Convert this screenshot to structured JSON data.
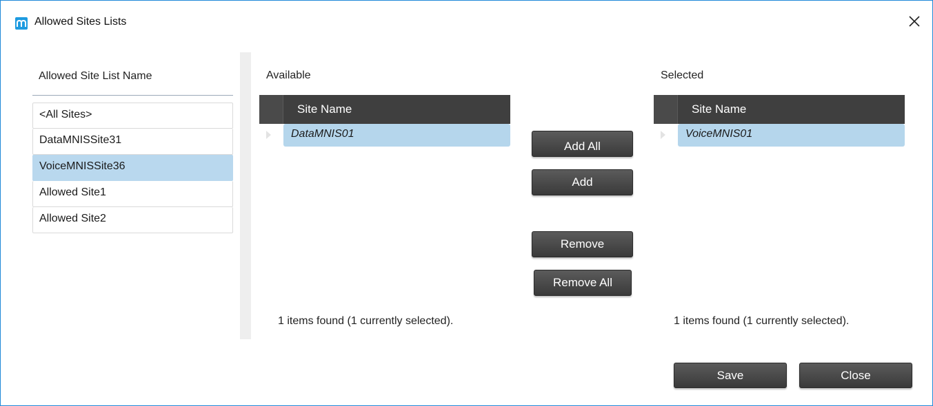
{
  "window": {
    "title": "Allowed Sites Lists",
    "close_symbol": "close-icon"
  },
  "site_list": {
    "header": "Allowed Site List Name",
    "items": [
      {
        "label": "<All Sites>",
        "selected": false
      },
      {
        "label": "DataMNISSite31",
        "selected": false
      },
      {
        "label": "VoiceMNISSite36",
        "selected": true
      },
      {
        "label": "Allowed Site1",
        "selected": false
      },
      {
        "label": "Allowed Site2",
        "selected": false
      }
    ]
  },
  "available": {
    "label": "Available",
    "column": "Site Name",
    "rows": [
      "DataMNIS01"
    ],
    "count_text": "1 items found (1 currently selected)."
  },
  "selected": {
    "label": "Selected",
    "column": "Site Name",
    "rows": [
      "VoiceMNIS01"
    ],
    "count_text": "1 items found (1 currently selected)."
  },
  "buttons": {
    "add_all": "Add All",
    "add": "Add",
    "remove": "Remove",
    "remove_all": "Remove All",
    "save": "Save",
    "close": "Close"
  },
  "colors": {
    "accent": "#1e88d8",
    "selection": "#b5d6ec",
    "header_dark": "#3f3f3f"
  }
}
